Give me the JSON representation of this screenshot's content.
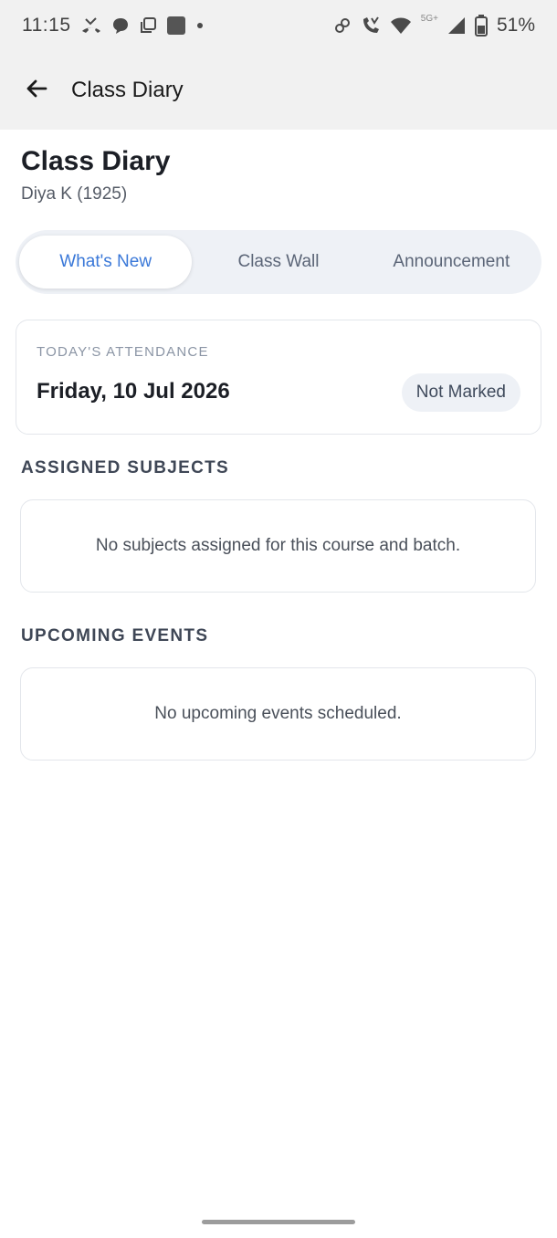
{
  "status_bar": {
    "time": "11:15",
    "network_label": "5G+",
    "battery": "51%",
    "left_icons": [
      "missed-call-icon",
      "chat-bubble-icon",
      "copy-icon",
      "app-square-icon",
      "dot-icon"
    ],
    "right_icons": [
      "link-icon",
      "wifi-calling-icon",
      "wifi-icon",
      "signal-icon",
      "battery-icon"
    ]
  },
  "app_bar": {
    "title": "Class Diary",
    "back_icon": "arrow-left-icon"
  },
  "page": {
    "title": "Class Diary",
    "subtitle": "Diya K (1925)"
  },
  "tabs": [
    {
      "label": "What's New",
      "active": true
    },
    {
      "label": "Class Wall",
      "active": false
    },
    {
      "label": "Announcement",
      "active": false
    }
  ],
  "attendance": {
    "label": "TODAY'S ATTENDANCE",
    "date": "Friday, 10 Jul 2026",
    "status": "Not Marked"
  },
  "assigned_subjects": {
    "heading": "ASSIGNED SUBJECTS",
    "empty_text": "No subjects assigned for this course and batch."
  },
  "upcoming_events": {
    "heading": "UPCOMING EVENTS",
    "empty_text": "No upcoming events scheduled."
  },
  "colors": {
    "accent": "#3a78d8",
    "header_bg": "#f1f1f1",
    "tab_track": "#eef1f6"
  }
}
